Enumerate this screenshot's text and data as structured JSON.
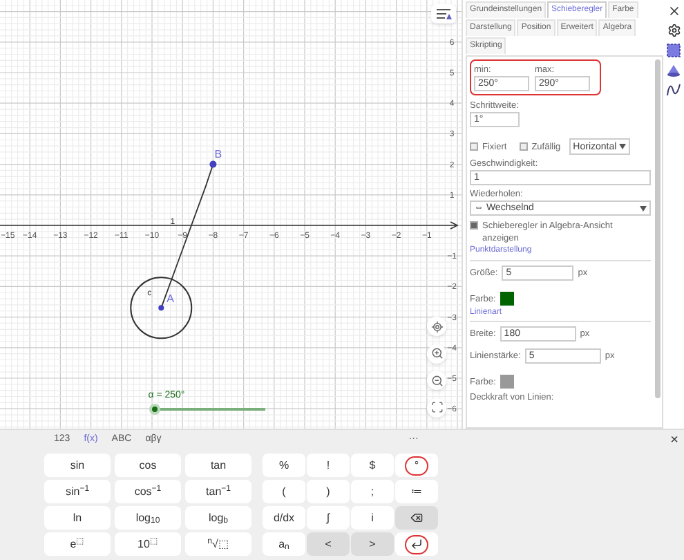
{
  "graphics": {
    "x_axis_labels": [
      "−15",
      "−14",
      "−13",
      "−12",
      "−11",
      "−10",
      "−9",
      "−8",
      "−7",
      "−6",
      "−5",
      "−4",
      "−3",
      "−2",
      "−1"
    ],
    "y_axis_labels": [
      "6",
      "5",
      "4",
      "3",
      "2",
      "1",
      "−1",
      "−2",
      "−3",
      "−4",
      "−5",
      "−6"
    ],
    "points": [
      {
        "label": "B"
      },
      {
        "label": "A"
      }
    ],
    "circle_label": "c",
    "segment_label": "1",
    "slider": {
      "label": "α = 250°",
      "level": 0
    }
  },
  "properties": {
    "tab_rows": [
      [
        {
          "label": "Grundeinstellungen",
          "selected": false
        },
        {
          "label": "Schieberegler",
          "selected": true
        },
        {
          "label": "Farbe",
          "selected": false
        }
      ],
      [
        {
          "label": "Darstellung",
          "selected": false
        },
        {
          "label": "Position",
          "selected": false
        },
        {
          "label": "Erweitert",
          "selected": false
        },
        {
          "label": "Algebra",
          "selected": false
        }
      ],
      [
        {
          "label": "Skripting",
          "selected": false
        }
      ]
    ],
    "range": {
      "highlighted": true,
      "min_label": "min:",
      "min": "250°",
      "max_label": "max:",
      "max": "290°"
    },
    "step": {
      "label": "Schrittweite:",
      "value": "1°"
    },
    "fixed": {
      "label": "Fixiert",
      "checked": false
    },
    "random": {
      "label": "Zufällig",
      "checked": false
    },
    "orientation": "Horizontal",
    "speed": {
      "label": "Geschwindigkeit:",
      "value": "1"
    },
    "repeat": {
      "label": "Wiederholen:",
      "value": "⇔ Wechselnd"
    },
    "show_in_algebra": {
      "label": "Schieberegler in Algebra-Ansicht anzeigen",
      "checked": true
    },
    "point_style_link": "Punktdarstellung",
    "point_size": {
      "label": "Größe:",
      "value": "5",
      "unit": "px"
    },
    "point_color": {
      "label": "Farbe:",
      "color": "#006400"
    },
    "line_style_link": "Linienart",
    "width": {
      "label": "Breite:",
      "value": "180",
      "unit": "px"
    },
    "line_thickness": {
      "label": "Linienstärke:",
      "value": "5",
      "unit": "px"
    },
    "line_color": {
      "label": "Farbe:",
      "color": "#999999"
    },
    "line_opacity_label": "Deckkraft von Linien:"
  },
  "keyboard": {
    "tabs": [
      {
        "label": "123",
        "selected": false
      },
      {
        "label": "f(x)",
        "selected": true
      },
      {
        "label": "ABC",
        "selected": false
      },
      {
        "label": "αβγ",
        "selected": false
      }
    ],
    "more": "···",
    "close": "×",
    "left_keys": [
      [
        {
          "label": "sin"
        },
        {
          "label": "cos"
        },
        {
          "label": "tan"
        }
      ],
      [
        {
          "label": "sin$^{−1}$"
        },
        {
          "label": "cos$^{−1}$"
        },
        {
          "label": "tan$^{−1}$"
        }
      ],
      [
        {
          "label": "ln"
        },
        {
          "label": "log$_{10}$"
        },
        {
          "label": "log$_{b}$"
        }
      ],
      [
        {
          "label": "e$^{⬚}$"
        },
        {
          "label": "10$^{⬚}$"
        },
        {
          "label": "$^{n}$√⬚"
        }
      ]
    ],
    "right_keys": [
      [
        {
          "kind": "text",
          "label": "%",
          "highlighted": false
        },
        {
          "kind": "text",
          "label": "!",
          "highlighted": false
        },
        {
          "kind": "text",
          "label": "$",
          "highlighted": false
        },
        {
          "kind": "text",
          "label": "°",
          "highlighted": true
        }
      ],
      [
        {
          "kind": "text",
          "label": "(",
          "highlighted": false
        },
        {
          "kind": "text",
          "label": ")",
          "highlighted": false
        },
        {
          "kind": "text",
          "label": ";",
          "highlighted": false
        },
        {
          "kind": "text",
          "label": "≔",
          "highlighted": false
        }
      ],
      [
        {
          "kind": "text",
          "label": "d/dx",
          "highlighted": false
        },
        {
          "kind": "text",
          "label": "∫",
          "highlighted": false
        },
        {
          "kind": "text",
          "label": "i",
          "highlighted": false
        },
        {
          "kind": "backspace",
          "highlighted": false
        }
      ],
      [
        {
          "kind": "text",
          "label": "a$_{n}$",
          "highlighted": false
        },
        {
          "kind": "nav",
          "label": "<",
          "highlighted": false
        },
        {
          "kind": "nav",
          "label": ">",
          "highlighted": false
        },
        {
          "kind": "enter",
          "highlighted": true
        }
      ]
    ]
  }
}
